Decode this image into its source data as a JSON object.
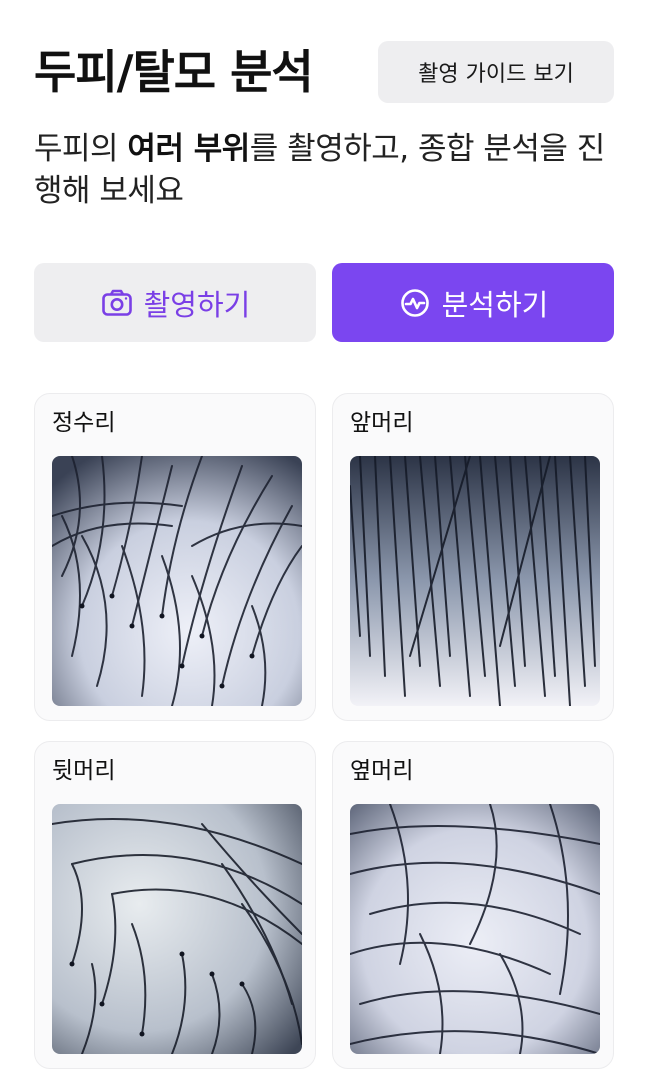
{
  "header": {
    "title": "두피/탈모 분석",
    "guide_button": "촬영 가이드 보기"
  },
  "description": {
    "part1": "두피의 ",
    "bold": "여러 부위",
    "part2": "를 촬영하고, 종합 분석을 진행해 보세요"
  },
  "actions": {
    "capture_label": "촬영하기",
    "capture_icon": "camera-icon",
    "analyze_label": "분석하기",
    "analyze_icon": "pulse-icon"
  },
  "colors": {
    "accent": "#7b46f0",
    "accent_text": "#7a3fe6",
    "button_gray": "#eeeef0"
  },
  "regions": [
    {
      "label": "정수리",
      "image": "scalp-crown-photo"
    },
    {
      "label": "앞머리",
      "image": "scalp-front-photo"
    },
    {
      "label": "뒷머리",
      "image": "scalp-back-photo"
    },
    {
      "label": "옆머리",
      "image": "scalp-side-photo"
    }
  ]
}
